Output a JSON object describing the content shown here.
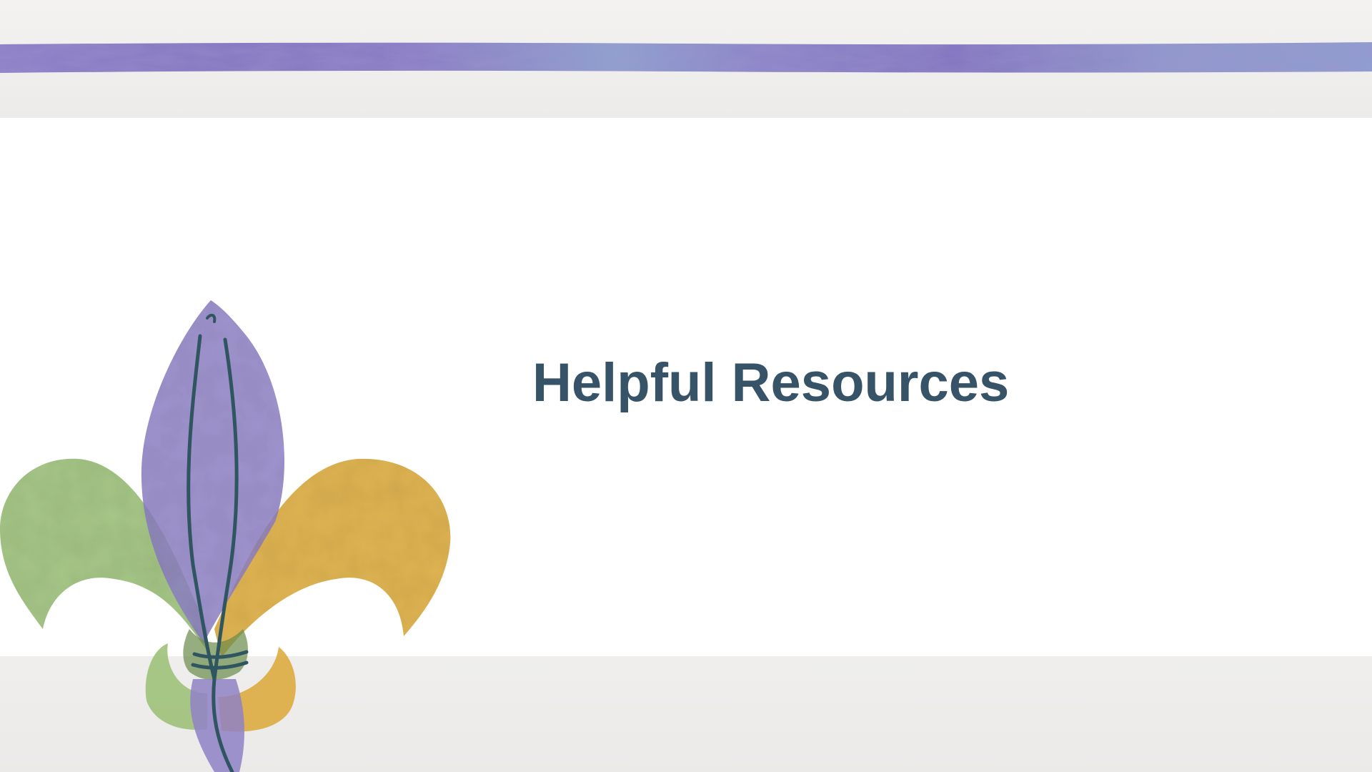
{
  "slide": {
    "title": "Helpful Resources"
  },
  "decoration": {
    "fleur_de_lis_icon": "fleur-de-lis",
    "colors": {
      "purple": "#8f81c6",
      "green": "#9dc17a",
      "gold": "#dcaa3a",
      "outline": "#2f5560",
      "title": "#375367",
      "stripe": "#8a7cc4"
    }
  }
}
